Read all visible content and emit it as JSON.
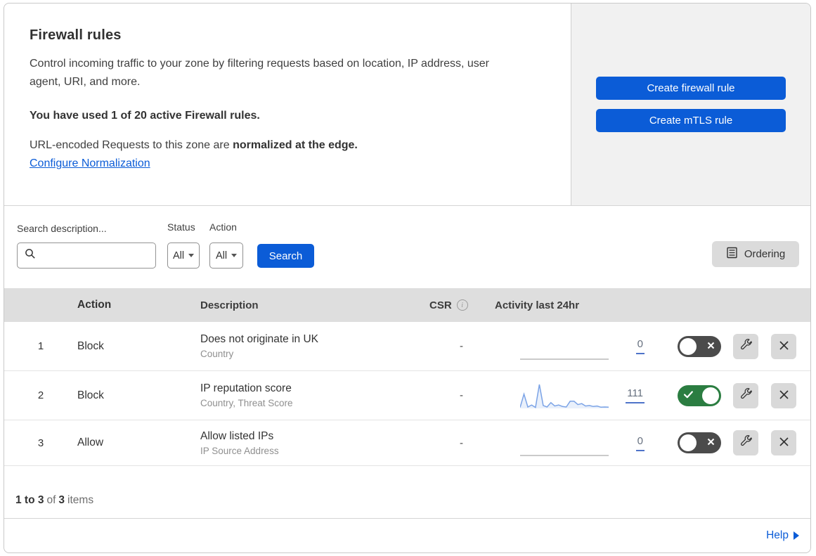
{
  "colors": {
    "primary_blue": "#0b5cd7",
    "link_blue": "#0b5cd7",
    "toggle_on_green": "#2b7d41",
    "toggle_off_gray": "#4b4b4b",
    "sparkline_blue": "#7ba3e6",
    "table_header_gray": "#dedede",
    "side_panel_gray": "#f1f1f1"
  },
  "header": {
    "title": "Firewall rules",
    "description": "Control incoming traffic to your zone by filtering requests based on location, IP address, user agent, URI, and more.",
    "usage": "You have used 1 of 20 active Firewall rules.",
    "normalization_prefix": "URL-encoded Requests to this zone are ",
    "normalization_bold": "normalized at the edge.",
    "normalization_link": "Configure Normalization"
  },
  "actions_panel": {
    "create_firewall_label": "Create firewall rule",
    "create_mtls_label": "Create mTLS rule"
  },
  "filters": {
    "search_label": "Search description...",
    "status_label": "Status",
    "status_value": "All",
    "action_label": "Action",
    "action_value": "All",
    "search_button_label": "Search",
    "ordering_button_label": "Ordering"
  },
  "icons": {
    "info_glyph": "i"
  },
  "table": {
    "columns": {
      "action": "Action",
      "description": "Description",
      "csr": "CSR",
      "activity": "Activity last 24hr"
    },
    "rows": [
      {
        "index": "1",
        "action": "Block",
        "description": "Does not originate in UK",
        "fields": "Country",
        "csr": "-",
        "activity_count": "0",
        "enabled": false,
        "sparkline": [
          0,
          0
        ]
      },
      {
        "index": "2",
        "action": "Block",
        "description": "IP reputation score",
        "fields": "Country, Threat Score",
        "csr": "-",
        "activity_count": "111",
        "enabled": true,
        "sparkline": [
          4,
          60,
          6,
          14,
          4,
          100,
          12,
          6,
          24,
          10,
          14,
          8,
          6,
          30,
          30,
          16,
          20,
          10,
          12,
          8,
          10,
          5,
          6,
          5
        ]
      },
      {
        "index": "3",
        "action": "Allow",
        "description": "Allow listed IPs",
        "fields": "IP Source Address",
        "csr": "-",
        "activity_count": "0",
        "enabled": false,
        "sparkline": [
          0,
          0
        ]
      }
    ]
  },
  "footer": {
    "range": "1 to 3",
    "of_label": "of",
    "total": "3",
    "items_label": "items",
    "help_label": "Help"
  }
}
